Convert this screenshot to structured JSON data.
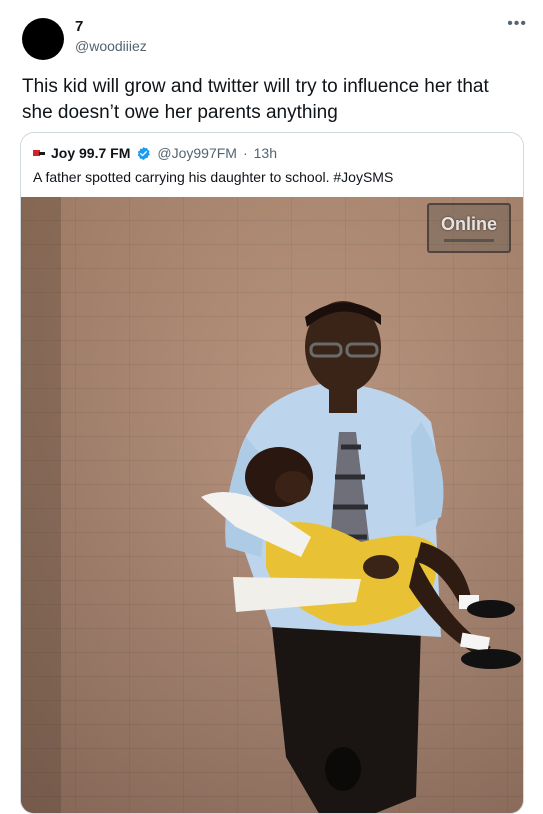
{
  "author": {
    "display_name": "7",
    "handle": "@woodiiiez",
    "more_icon": "more-horizontal-icon"
  },
  "tweet": {
    "text": "This kid will grow and twitter will try to influence her that she doesn’t owe her parents anything"
  },
  "quoted_tweet": {
    "display_name": "Joy 99.7 FM",
    "verified": true,
    "handle": "@Joy997FM",
    "separator": "·",
    "time": "13h",
    "text": "A father spotted carrying his daughter to school. #JoySMS",
    "image": {
      "watermark": "Online",
      "description": "man-in-blue-shirt-carrying-child-in-yellow-uniform"
    }
  },
  "colors": {
    "text_primary": "#0f1419",
    "text_secondary": "#536471",
    "border": "#cfd9de",
    "verified_blue": "#1d9bf0"
  }
}
